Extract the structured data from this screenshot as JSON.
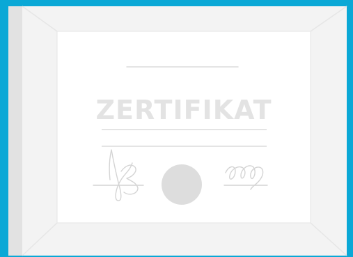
{
  "certificate": {
    "title": "ZERTIFIKAT",
    "has_seal": true,
    "signature_count": 2
  },
  "colors": {
    "background": "#0aa8d6",
    "frame": "#f3f3f3",
    "frame_shadow": "#e2e2e2",
    "paper": "#ffffff",
    "title_text": "#e3e3e3",
    "lines": "#dcdcdc",
    "seal": "#dddddd",
    "signature_ink": "#d4d4d4"
  },
  "icons": {
    "signature_left": "signature-left-icon",
    "signature_right": "signature-right-icon",
    "seal": "seal-icon"
  }
}
